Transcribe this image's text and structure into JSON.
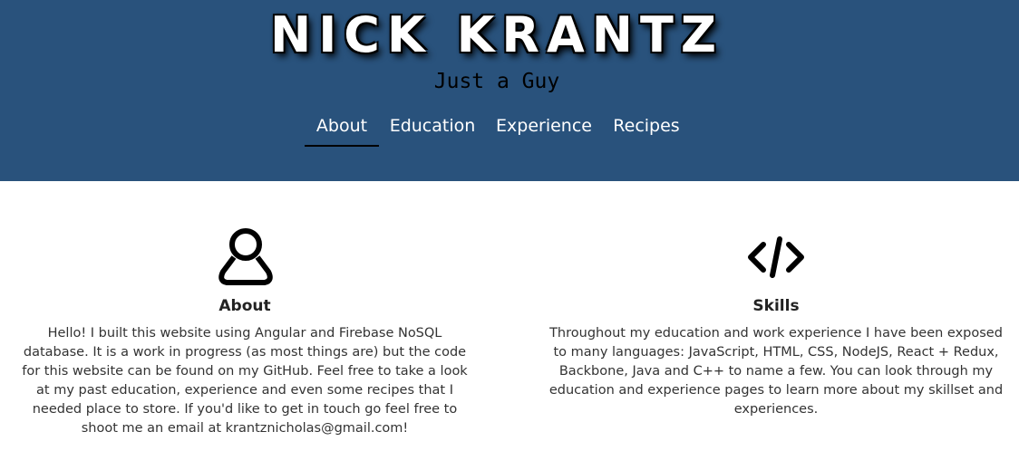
{
  "header": {
    "title": "NICK KRANTZ",
    "subtitle": "Just a Guy",
    "background_color": "#29527c"
  },
  "nav": {
    "items": [
      {
        "label": "About",
        "active": true
      },
      {
        "label": "Education",
        "active": false
      },
      {
        "label": "Experience",
        "active": false
      },
      {
        "label": "Recipes",
        "active": false
      }
    ]
  },
  "about": {
    "icon": "user-icon",
    "title": "About",
    "text": "Hello! I built this website using Angular and Firebase NoSQL database. It is a work in progress (as most things are) but the code for this website can be found on my GitHub. Feel free to take a look at my past education, experience and even some recipes that I needed place to store. If you'd like to get in touch go feel free to shoot me an email at krantznicholas@gmail.com!"
  },
  "skills": {
    "icon": "code-icon",
    "title": "Skills",
    "text": "Throughout my education and work experience I have been exposed to many languages: JavaScript, HTML, CSS, NodeJS, React + Redux, Backbone, Java and C++ to name a few. You can look through my education and experience pages to learn more about my skillset and experiences."
  }
}
